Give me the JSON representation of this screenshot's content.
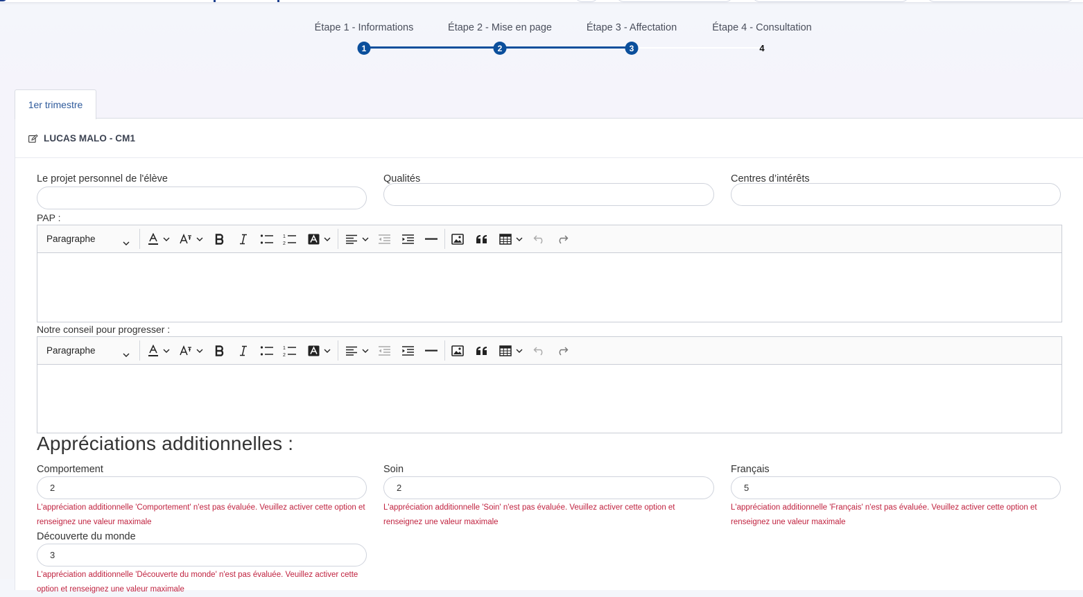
{
  "stepper": {
    "steps": [
      {
        "label": "Étape 1 - Informations",
        "number": "1"
      },
      {
        "label": "Étape 2 - Mise en page",
        "number": "2"
      },
      {
        "label": "Étape 3 - Affectation",
        "number": "3"
      },
      {
        "label": "Étape 4 - Consultation",
        "number": "4"
      }
    ],
    "active_step": 3,
    "accent_color": "#0b4f9c"
  },
  "tabs": [
    {
      "label": "1er trimestre",
      "active": true
    }
  ],
  "panel": {
    "title": "LUCAS MALO - CM1",
    "title_icon": "edit-icon"
  },
  "fields": {
    "projet": {
      "label": "Le projet personnel de l'élève",
      "value": ""
    },
    "qualites": {
      "label": "Qualités",
      "value": ""
    },
    "centres": {
      "label": "Centres d’intérêts",
      "value": ""
    }
  },
  "editors": [
    {
      "label": "PAP :",
      "block_format": "Paragraphe"
    },
    {
      "label": "Notre conseil pour progresser :",
      "block_format": "Paragraphe"
    }
  ],
  "toolbar_icons": [
    "font-color-icon",
    "font-size-icon",
    "bold-icon",
    "italic-icon",
    "bulleted-list-icon",
    "numbered-list-icon",
    "highlight-icon",
    "align-icon",
    "outdent-icon",
    "indent-icon",
    "horizontal-line-icon",
    "image-icon",
    "blockquote-icon",
    "table-icon",
    "undo-icon",
    "redo-icon"
  ],
  "appreciations": {
    "title": "Appréciations additionnelles :",
    "items": [
      {
        "label": "Comportement",
        "value": "2",
        "error": "L'appréciation additionnelle 'Comportement' n'est pas évaluée. Veuillez activer cette option et renseignez une valeur maximale"
      },
      {
        "label": "Soin",
        "value": "2",
        "error": "L'appréciation additionnelle 'Soin' n'est pas évaluée. Veuillez activer cette option et renseignez une valeur maximale"
      },
      {
        "label": "Français",
        "value": "5",
        "error": "L'appréciation additionnelle 'Français' n'est pas évaluée. Veuillez activer cette option et renseignez une valeur maximale"
      },
      {
        "label": "Découverte du monde",
        "value": "3",
        "error": "L'appréciation additionnelle 'Découverte du monde' n'est pas évaluée. Veuillez activer cette option et renseignez une valeur maximale"
      }
    ],
    "error_color": "#c0223f"
  }
}
